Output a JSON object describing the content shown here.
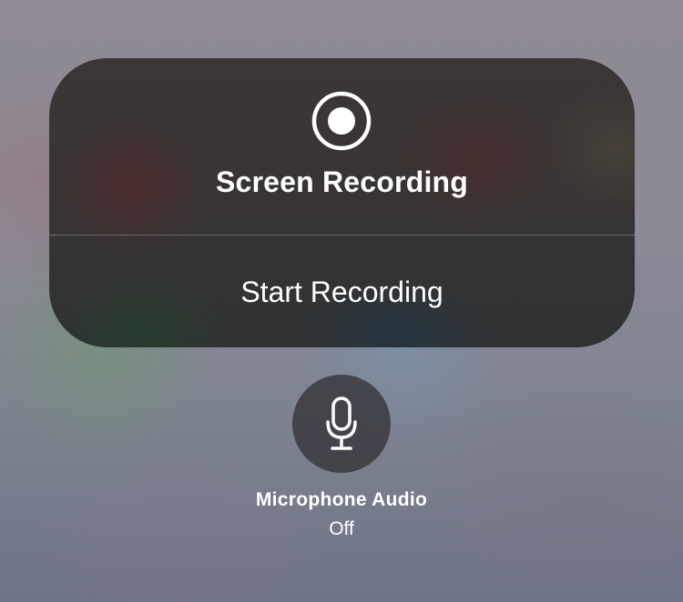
{
  "screen_recording": {
    "title": "Screen Recording",
    "icon": "record-icon",
    "start_label": "Start Recording"
  },
  "microphone": {
    "icon": "microphone-icon",
    "title": "Microphone Audio",
    "status": "Off"
  },
  "colors": {
    "panel_text": "#ffffff",
    "mic_button_bg": "#37373c"
  }
}
